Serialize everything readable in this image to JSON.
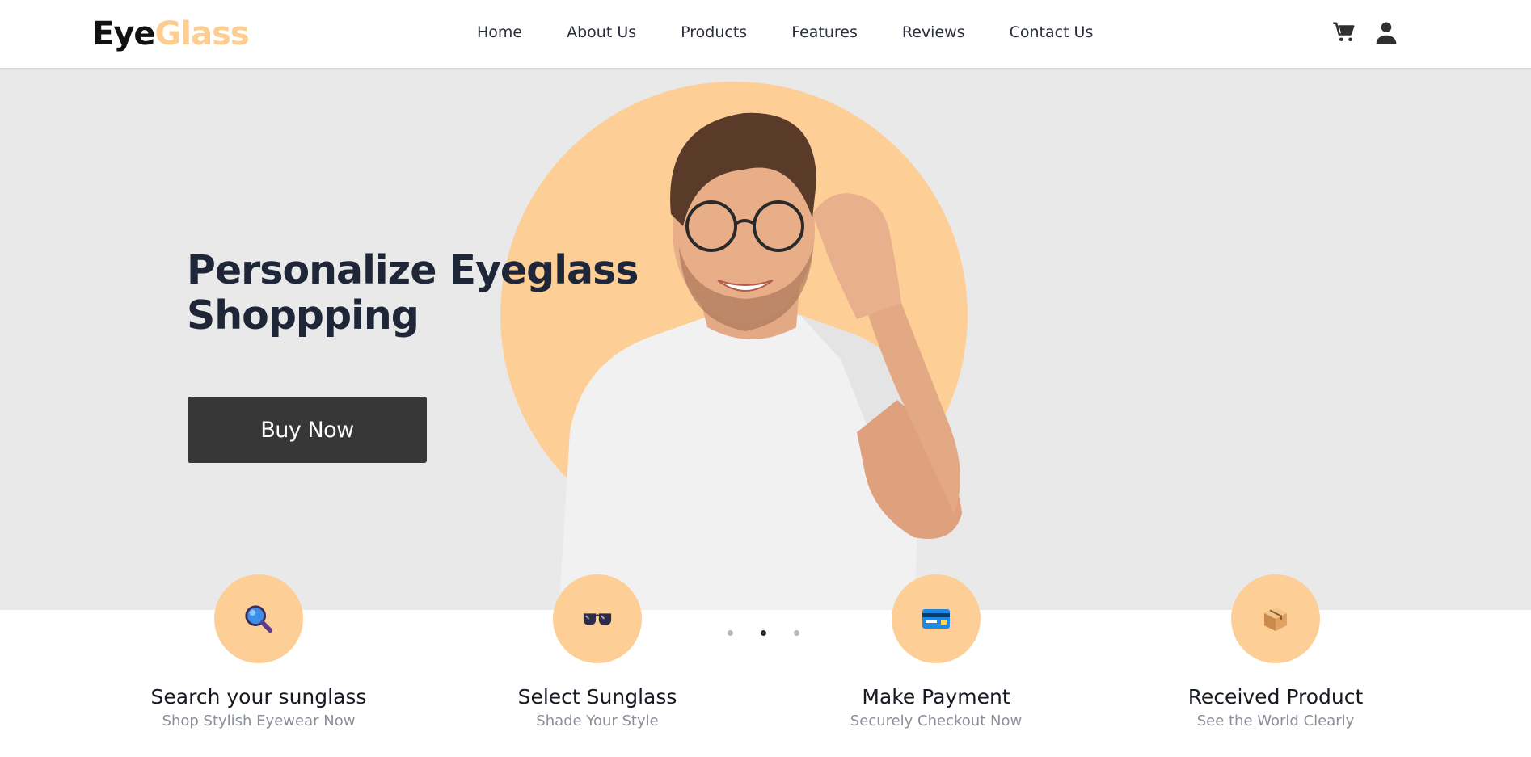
{
  "header": {
    "logo_part1": "Eye",
    "logo_part2": "Glass",
    "nav": [
      "Home",
      "About Us",
      "Products",
      "Features",
      "Reviews",
      "Contact Us"
    ],
    "icons": [
      "cart-icon",
      "user-icon"
    ]
  },
  "hero": {
    "title_line1": "Personalize Eyeglass",
    "title_line2": "Shoppping",
    "button_label": "Buy Now",
    "carousel_active_index": 1,
    "carousel_count": 3
  },
  "steps": [
    {
      "title": "Search your sunglass",
      "subtitle": "Shop Stylish Eyewear Now",
      "icon": "magnifier-icon"
    },
    {
      "title": "Select Sunglass",
      "subtitle": "Shade Your Style",
      "icon": "sunglasses-icon"
    },
    {
      "title": "Make Payment",
      "subtitle": "Securely Checkout Now",
      "icon": "credit-card-icon"
    },
    {
      "title": "Received Product",
      "subtitle": "See the World Clearly",
      "icon": "package-icon"
    }
  ],
  "colors": {
    "accent": "#fdcf96",
    "hero_bg": "#e9e9e9",
    "button_bg": "#373737",
    "title": "#1f2637"
  }
}
